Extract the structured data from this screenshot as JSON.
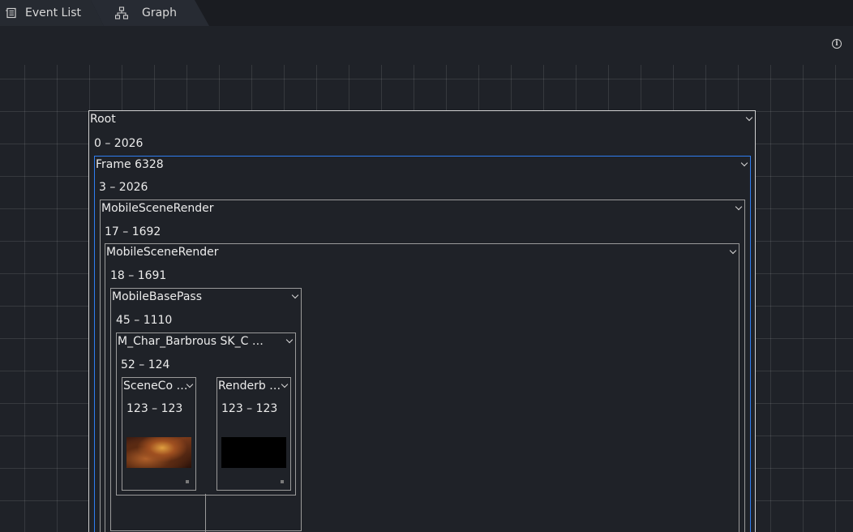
{
  "tabs": [
    {
      "label": "Event List",
      "icon": "event-list-icon",
      "active": false
    },
    {
      "label": "Graph",
      "icon": "graph-icon",
      "active": true
    }
  ],
  "toolbar": {
    "info_icon": "info-icon"
  },
  "graph": {
    "root": {
      "title": "Root",
      "range": "0 – 2026"
    },
    "frame": {
      "title": "Frame 6328",
      "range": "3 – 2026"
    },
    "msr_outer": {
      "title": "MobileSceneRender",
      "range": "17 – 1692"
    },
    "msr_inner": {
      "title": "MobileSceneRender",
      "range": "18 – 1691"
    },
    "basepass": {
      "title": "MobileBasePass",
      "range": "45 – 1110"
    },
    "char": {
      "title": "M_Char_Barbrous SK_C …",
      "range": "52 – 124"
    },
    "sceneco": {
      "title": "SceneCo …",
      "range": "123 – 123"
    },
    "renderb": {
      "title": "Renderb …",
      "range": "123 – 123"
    }
  },
  "colors": {
    "selected_border": "#2f7df0",
    "background": "#1f2228",
    "tabbar": "#1a1c21"
  }
}
